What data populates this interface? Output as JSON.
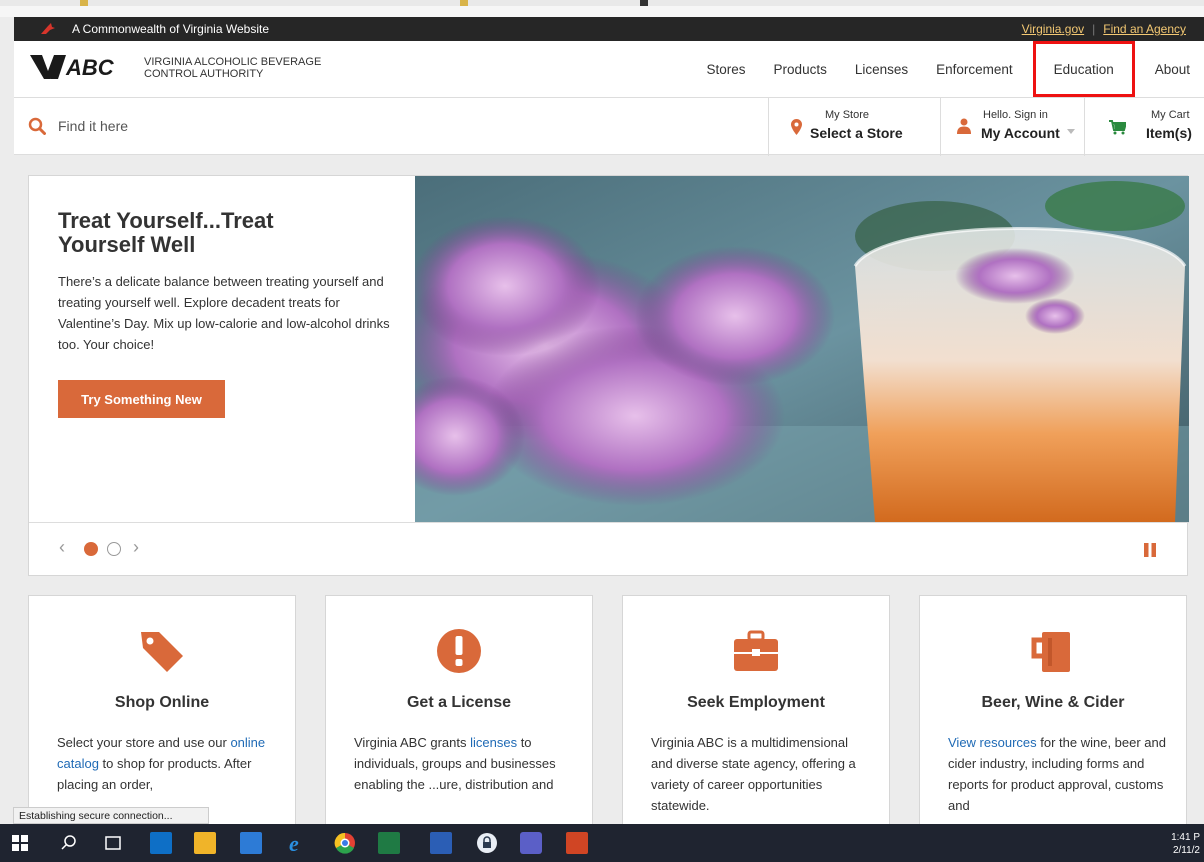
{
  "commonwealth": {
    "label": "A Commonwealth of Virginia Website",
    "links": [
      "Virginia.gov",
      "Find an Agency"
    ]
  },
  "header": {
    "logo_letters": "ABC",
    "agency_name": "VIRGINIA ALCOHOLIC BEVERAGE CONTROL AUTHORITY",
    "nav": [
      "Stores",
      "Products",
      "Licenses",
      "Enforcement",
      "Education",
      "About"
    ]
  },
  "utility": {
    "search_placeholder": "Find it here",
    "store": {
      "small": "My Store",
      "big": "Select a Store"
    },
    "account": {
      "small": "Hello. Sign in",
      "big": "My Account"
    },
    "cart": {
      "small": "My Cart",
      "big": "Item(s)"
    }
  },
  "hero": {
    "title": "Treat Yourself...Treat Yourself Well",
    "body": "There’s a delicate balance between treating yourself and treating yourself well. Explore decadent treats for Valentine’s Day. Mix up low-calorie and low-alcohol drinks too. Your choice!",
    "button": "Try Something New",
    "prev": "‹",
    "next": "›"
  },
  "cards": [
    {
      "title": "Shop Online",
      "pre": "Select your store and use our ",
      "link": "online catalog",
      "post": " to shop for products. After placing an order,"
    },
    {
      "title": "Get a License",
      "pre": "Virginia ABC grants ",
      "link": "licenses",
      "post": " to individuals, groups and businesses enabling the ...ure, distribution and"
    },
    {
      "title": "Seek Employment",
      "pre": "Virginia ABC is a multidimensional and diverse state agency, offering a variety of career opportunities statewide.",
      "link": "",
      "post": ""
    },
    {
      "title": "Beer, Wine & Cider",
      "pre": "",
      "link": "View resources",
      "post": " for the wine, beer and cider industry, including forms and reports for product approval, customs and"
    }
  ],
  "status_text": "Establishing secure connection...",
  "clock": {
    "time": "1:41 P",
    "date": "2/11/2"
  },
  "colors": {
    "accent": "#d9693a",
    "link": "#1f6ab5",
    "highlight": "#e11111"
  }
}
